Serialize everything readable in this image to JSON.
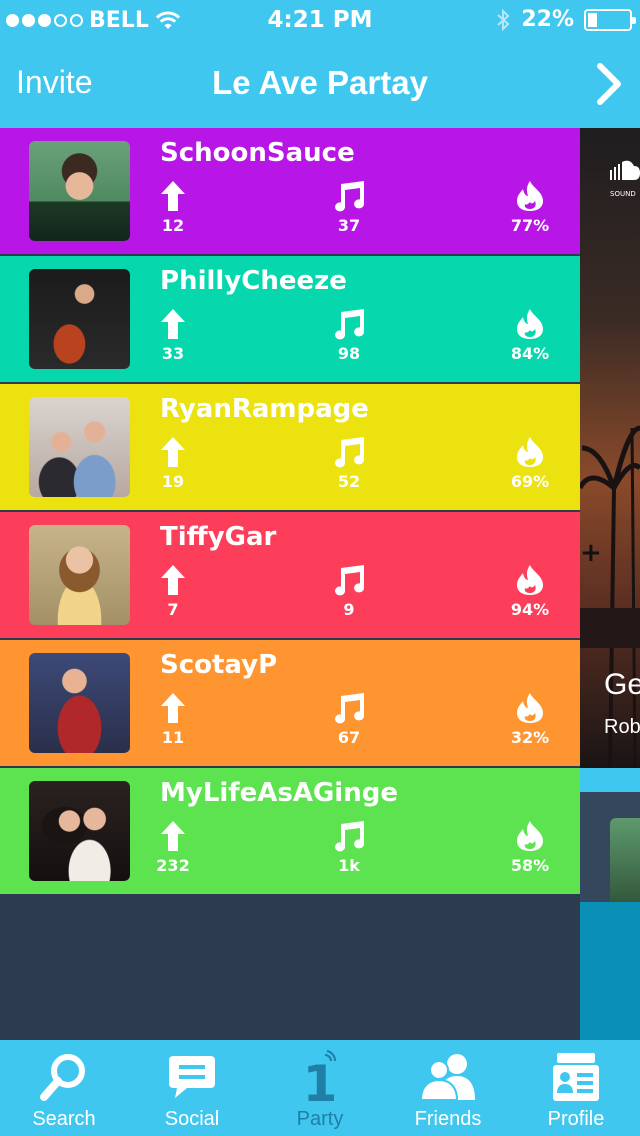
{
  "status_bar": {
    "carrier": "BELL",
    "time": "4:21 PM",
    "battery": "22%",
    "signal_bars_filled": 3,
    "signal_bars_total": 5
  },
  "nav": {
    "left_label": "Invite",
    "title": "Le Ave Partay",
    "right_icon": "chevron-right-icon"
  },
  "members": [
    {
      "name": "SchoonSauce",
      "upvotes": "12",
      "songs": "37",
      "hot": "77%",
      "color": "#b716e6"
    },
    {
      "name": "PhillyCheeze",
      "upvotes": "33",
      "songs": "98",
      "hot": "84%",
      "color": "#06d7ac"
    },
    {
      "name": "RyanRampage",
      "upvotes": "19",
      "songs": "52",
      "hot": "69%",
      "color": "#ebe20f"
    },
    {
      "name": "TiffyGar",
      "upvotes": "7",
      "songs": "9",
      "hot": "94%",
      "color": "#fc3e5b"
    },
    {
      "name": "ScotayP",
      "upvotes": "11",
      "songs": "67",
      "hot": "32%",
      "color": "#fe9530"
    },
    {
      "name": "MyLifeAsAGinge",
      "upvotes": "232",
      "songs": "1k",
      "hot": "58%",
      "color": "#5de350"
    }
  ],
  "peek": {
    "title": "Ge",
    "artist": "Rob",
    "logo_text": "SOUND"
  },
  "tabs": [
    {
      "label": "Search",
      "icon": "search-icon"
    },
    {
      "label": "Social",
      "icon": "chat-bubble-icon"
    },
    {
      "label": "Party",
      "icon": "party-number-icon",
      "active": true,
      "badge": "1"
    },
    {
      "label": "Friends",
      "icon": "friends-icon"
    },
    {
      "label": "Profile",
      "icon": "profile-card-icon"
    }
  ],
  "colors": {
    "accent": "#3fc7ef",
    "background": "#2d3b4e",
    "active_tab": "#1f7fa6"
  }
}
